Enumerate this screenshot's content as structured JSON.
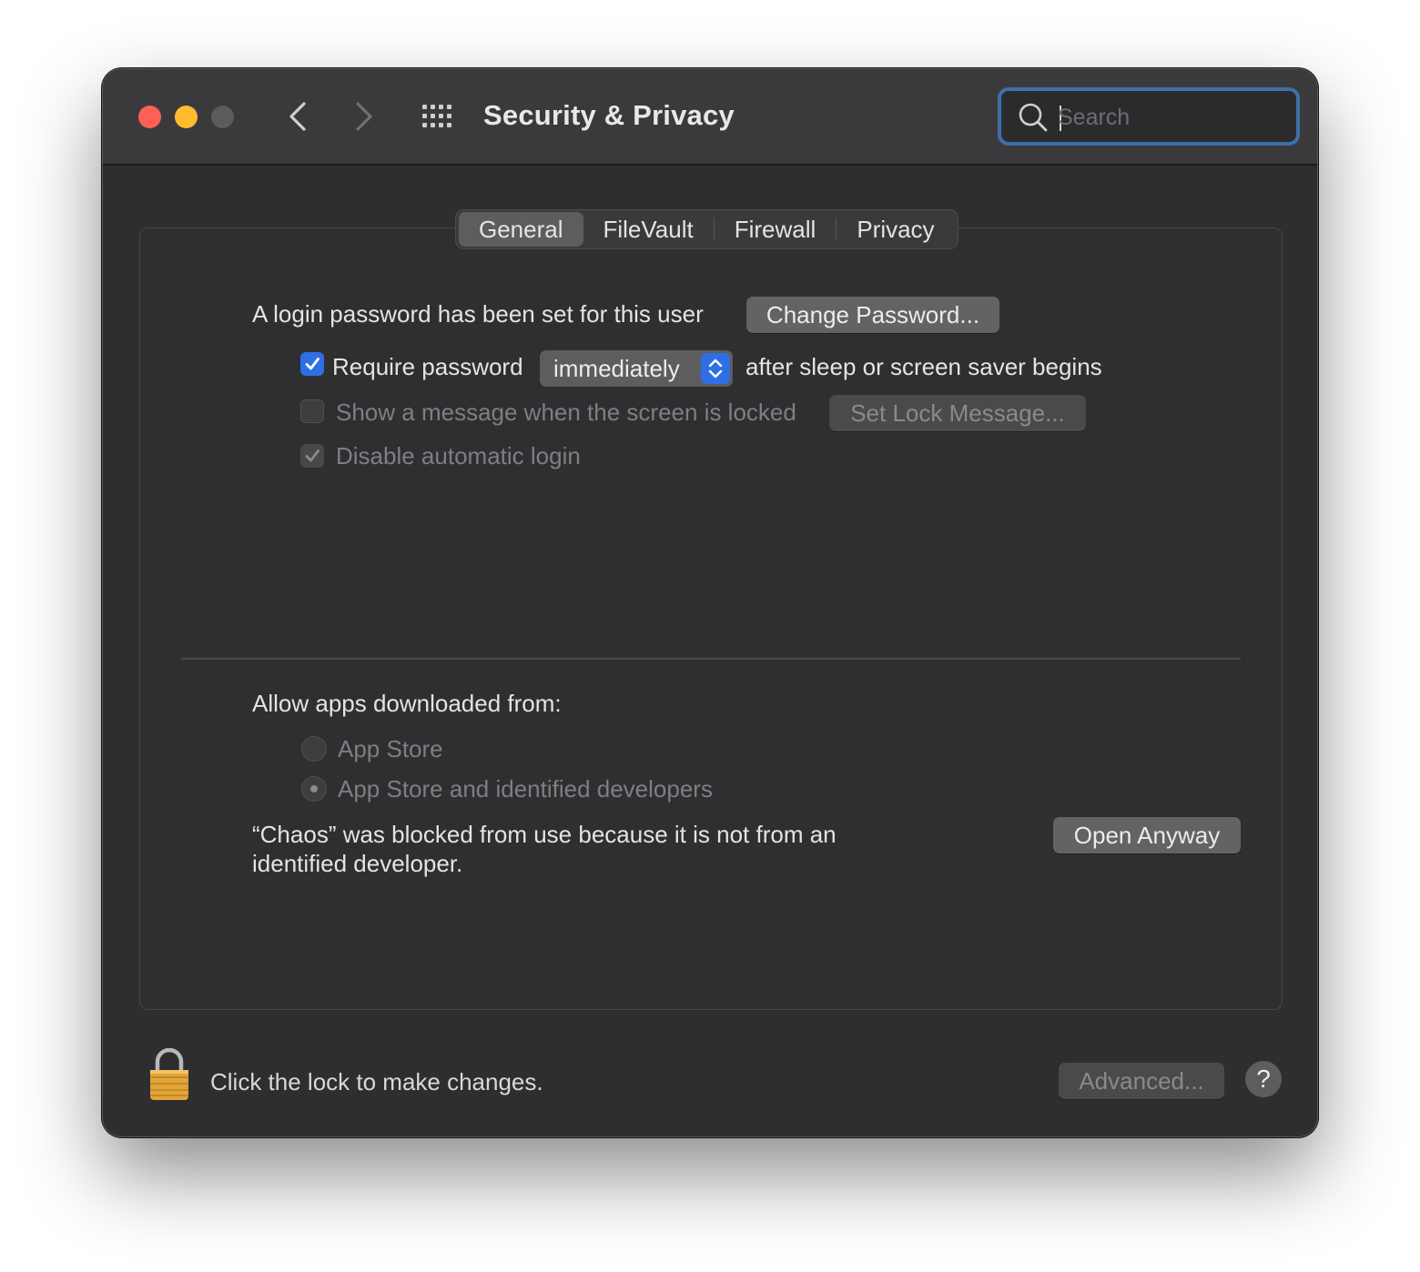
{
  "window": {
    "title": "Security & Privacy"
  },
  "search": {
    "placeholder": "Search",
    "value": ""
  },
  "tabs": [
    {
      "label": "General",
      "active": true
    },
    {
      "label": "FileVault",
      "active": false
    },
    {
      "label": "Firewall",
      "active": false
    },
    {
      "label": "Privacy",
      "active": false
    }
  ],
  "general": {
    "login_text": "A login password has been set for this user",
    "change_password_button": "Change Password...",
    "require_password": {
      "label": "Require password",
      "checked": true
    },
    "require_password_popup": "immediately",
    "require_password_suffix": "after sleep or screen saver begins",
    "show_message": {
      "label": "Show a message when the screen is locked",
      "checked": false,
      "enabled": false
    },
    "set_lock_message_button": "Set Lock Message...",
    "disable_auto_login": {
      "label": "Disable automatic login",
      "checked": true,
      "enabled": false
    },
    "allow_apps_heading": "Allow apps downloaded from:",
    "radio_options": [
      {
        "label": "App Store",
        "selected": false
      },
      {
        "label": "App Store and identified developers",
        "selected": true
      }
    ],
    "blocked_text_line1": "“Chaos” was blocked from use because it is not from an",
    "blocked_text_line2": "identified developer.",
    "open_anyway_button": "Open Anyway"
  },
  "footer": {
    "lock_text": "Click the lock to make changes.",
    "advanced_button": "Advanced...",
    "help_label": "?"
  },
  "colors": {
    "accent": "#2f6fe6",
    "close": "#ff5f57",
    "minimize": "#febc2e",
    "zoom_disabled": "#5b5b5d",
    "window_bg": "#2e2e30"
  }
}
